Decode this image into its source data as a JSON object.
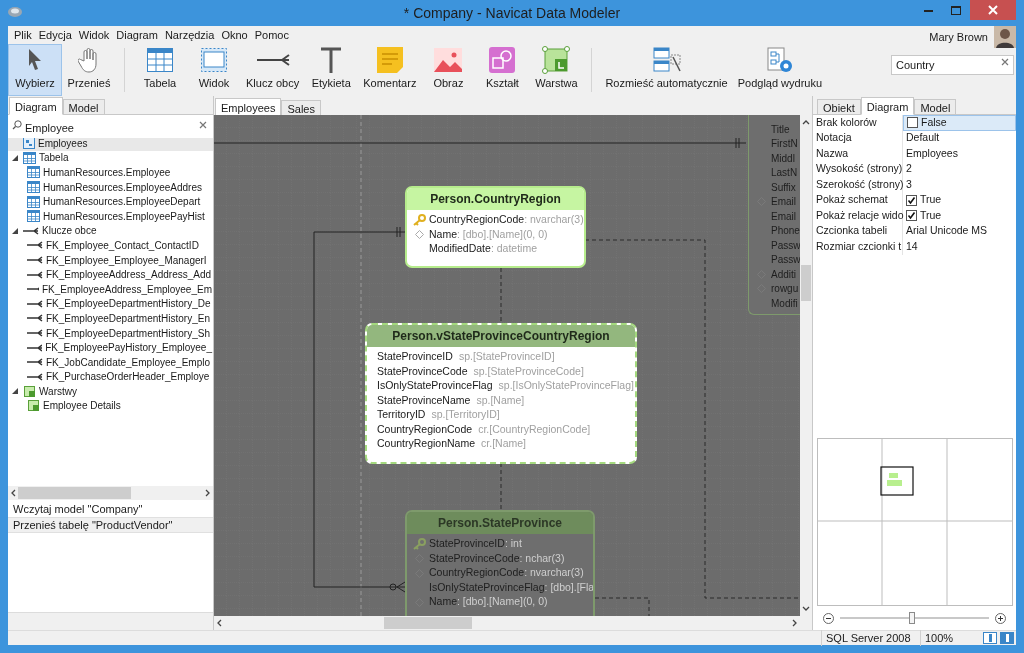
{
  "window": {
    "title": "* Company - Navicat Data Modeler"
  },
  "menu": [
    "Plik",
    "Edycja",
    "Widok",
    "Diagram",
    "Narzędzia",
    "Okno",
    "Pomoc"
  ],
  "user": {
    "name": "Mary Brown"
  },
  "toolbar": {
    "groups": [
      [
        {
          "label": "Wybierz",
          "selected": true
        },
        {
          "label": "Przenieś",
          "selected": false
        }
      ],
      [
        {
          "label": "Tabela",
          "selected": false
        },
        {
          "label": "Widok",
          "selected": false
        },
        {
          "label": "Klucz obcy",
          "selected": false
        },
        {
          "label": "Etykieta",
          "selected": false
        },
        {
          "label": "Komentarz",
          "selected": false
        },
        {
          "label": "Obraz",
          "selected": false
        },
        {
          "label": "Kształt",
          "selected": false
        },
        {
          "label": "Warstwa",
          "selected": false
        }
      ],
      [
        {
          "label": "Rozmieść automatycznie",
          "selected": false
        },
        {
          "label": "Podgląd wydruku",
          "selected": false
        }
      ]
    ]
  },
  "search": {
    "value": "Country"
  },
  "left_panel": {
    "tabs": [
      {
        "label": "Diagram",
        "selected": true
      },
      {
        "label": "Model",
        "selected": false
      }
    ],
    "search": {
      "value": "Employee"
    },
    "tree": [
      {
        "label": "Employees",
        "kind": "diagram",
        "selected": true
      },
      {
        "label": "Tabela",
        "kind": "table",
        "selected": false,
        "expanded": true,
        "children": [
          {
            "label": "HumanResources.Employee",
            "kind": "table",
            "selected": false
          },
          {
            "label": "HumanResources.EmployeeAddres",
            "kind": "table",
            "selected": false
          },
          {
            "label": "HumanResources.EmployeeDepart",
            "kind": "table",
            "selected": false
          },
          {
            "label": "HumanResources.EmployeePayHist",
            "kind": "table",
            "selected": false
          }
        ]
      },
      {
        "label": "Klucze obce",
        "kind": "foreign-key",
        "selected": false,
        "expanded": true,
        "children": [
          {
            "label": "FK_Employee_Contact_ContactID",
            "kind": "foreign-key",
            "selected": false
          },
          {
            "label": "FK_Employee_Employee_ManagerI",
            "kind": "foreign-key",
            "selected": false
          },
          {
            "label": "FK_EmployeeAddress_Address_Add",
            "kind": "foreign-key",
            "selected": false
          },
          {
            "label": "FK_EmployeeAddress_Employee_Em",
            "kind": "foreign-key",
            "selected": false
          },
          {
            "label": "FK_EmployeeDepartmentHistory_De",
            "kind": "foreign-key",
            "selected": false
          },
          {
            "label": "FK_EmployeeDepartmentHistory_En",
            "kind": "foreign-key",
            "selected": false
          },
          {
            "label": "FK_EmployeeDepartmentHistory_Sh",
            "kind": "foreign-key",
            "selected": false
          },
          {
            "label": "FK_EmployeePayHistory_Employee_",
            "kind": "foreign-key",
            "selected": false
          },
          {
            "label": "FK_JobCandidate_Employee_Emplo",
            "kind": "foreign-key",
            "selected": false
          },
          {
            "label": "FK_PurchaseOrderHeader_Employe",
            "kind": "foreign-key",
            "selected": false
          }
        ]
      },
      {
        "label": "Warstwy",
        "kind": "layer",
        "selected": false,
        "expanded": true,
        "children": [
          {
            "label": "Employee Details",
            "kind": "layer",
            "selected": false
          }
        ]
      }
    ],
    "history": [
      {
        "label": "Wczytaj model \"Company\"",
        "selected": false
      },
      {
        "label": "Przenieś tabelę \"ProductVendor\"",
        "selected": true
      }
    ]
  },
  "canvas": {
    "tabs": [
      {
        "label": "Employees",
        "selected": true
      },
      {
        "label": "Sales",
        "selected": false
      }
    ],
    "entities": [
      {
        "kind": "table",
        "highlighted": false,
        "fields": [
          {
            "name": "Title",
            "kind": "plain"
          },
          {
            "name": "FirstN",
            "kind": "plain"
          },
          {
            "name": "Middl",
            "kind": "plain"
          },
          {
            "name": "LastN",
            "kind": "plain"
          },
          {
            "name": "Suffix",
            "kind": "plain"
          },
          {
            "name": "Email",
            "kind": "index"
          },
          {
            "name": "Email",
            "kind": "plain"
          },
          {
            "name": "Phone",
            "kind": "plain"
          },
          {
            "name": "Passw",
            "kind": "plain"
          },
          {
            "name": "Passw",
            "kind": "plain"
          },
          {
            "name": "Additi",
            "kind": "index"
          },
          {
            "name": "rowgu",
            "kind": "index"
          },
          {
            "name": "Modifi",
            "kind": "plain"
          }
        ]
      },
      {
        "kind": "table",
        "highlighted": true,
        "title": "Person.CountryRegion",
        "fields": [
          {
            "name": "CountryRegionCode",
            "type": ": nvarchar(3)",
            "kind": "primary"
          },
          {
            "name": "Name",
            "type": ": [dbo].[Name](0, 0)",
            "kind": "index"
          },
          {
            "name": "ModifiedDate",
            "type": ": datetime",
            "kind": "plain"
          }
        ]
      },
      {
        "kind": "view",
        "highlighted": true,
        "title": "Person.vStateProvinceCountryRegion",
        "fields": [
          {
            "name": "StateProvinceID",
            "type": "sp.[StateProvinceID]"
          },
          {
            "name": "StateProvinceCode",
            "type": "sp.[StateProvinceCode]"
          },
          {
            "name": "IsOnlyStateProvinceFlag",
            "type": "sp.[IsOnlyStateProvinceFlag]"
          },
          {
            "name": "StateProvinceName",
            "type": "sp.[Name]"
          },
          {
            "name": "TerritoryID",
            "type": "sp.[TerritoryID]"
          },
          {
            "name": "CountryRegionCode",
            "type": "cr.[CountryRegionCode]"
          },
          {
            "name": "CountryRegionName",
            "type": "cr.[Name]"
          }
        ]
      },
      {
        "kind": "table",
        "highlighted": false,
        "title": "Person.StateProvince",
        "fields": [
          {
            "name": "StateProvinceID",
            "type": ": int",
            "kind": "primary"
          },
          {
            "name": "StateProvinceCode",
            "type": ": nchar(3)",
            "kind": "index"
          },
          {
            "name": "CountryRegionCode",
            "type": ": nvarchar(3)",
            "kind": "index"
          },
          {
            "name": "IsOnlyStateProvinceFlag",
            "type": ": [dbo].[Fla",
            "kind": "plain"
          },
          {
            "name": "Name",
            "type": ": [dbo].[Name](0, 0)",
            "kind": "index"
          }
        ]
      }
    ]
  },
  "properties": {
    "tabs": [
      {
        "label": "Obiekt",
        "selected": false
      },
      {
        "label": "Diagram",
        "selected": true
      },
      {
        "label": "Model",
        "selected": false
      }
    ],
    "rows": [
      {
        "name": "Brak kolorów",
        "value": "False",
        "kind": "checkbox",
        "checked": false,
        "selected": true
      },
      {
        "name": "Notacja",
        "value": "Default",
        "kind": "text",
        "selected": false
      },
      {
        "name": "Nazwa",
        "value": "Employees",
        "kind": "text",
        "selected": false
      },
      {
        "name": "Wysokość (strony)",
        "value": "2",
        "kind": "text",
        "selected": false
      },
      {
        "name": "Szerokość (strony)",
        "value": "3",
        "kind": "text",
        "selected": false
      },
      {
        "name": "Pokaż schemat",
        "value": "True",
        "kind": "checkbox",
        "checked": true,
        "selected": false
      },
      {
        "name": "Pokaż relacje wido",
        "value": "True",
        "kind": "checkbox",
        "checked": true,
        "selected": false
      },
      {
        "name": "Czcionka tabeli",
        "value": "Arial Unicode MS",
        "kind": "text",
        "selected": false
      },
      {
        "name": "Rozmiar czcionki t",
        "value": "14",
        "kind": "text",
        "selected": false
      }
    ]
  },
  "zoom": {
    "level": 0.48
  },
  "status_bar": {
    "server": "SQL Server 2008",
    "zoom": "100%",
    "views": [
      {
        "selected": false
      },
      {
        "selected": true
      }
    ]
  }
}
